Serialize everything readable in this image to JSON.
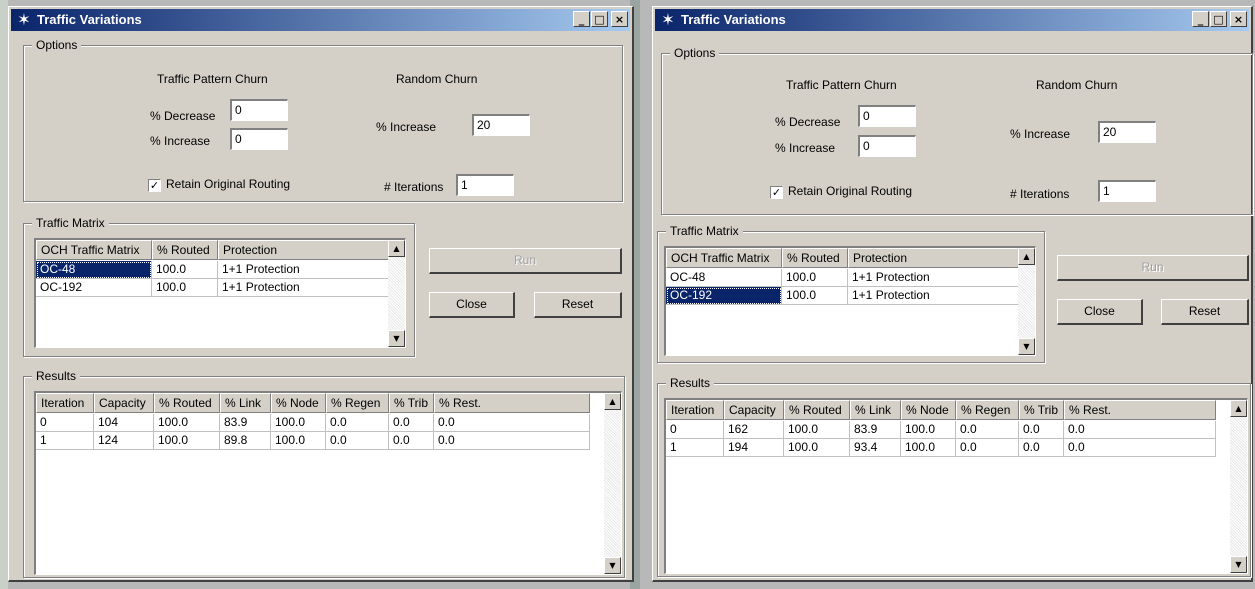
{
  "windows": [
    {
      "title": "Traffic Variations",
      "title_buttons": {
        "minimize": "_",
        "maximize": "□",
        "close": "×"
      },
      "options": {
        "legend": "Options",
        "traffic_pattern_churn": "Traffic Pattern Churn",
        "random_churn": "Random Churn",
        "decrease_label": "% Decrease",
        "decrease_value": "0",
        "increase_label": "% Increase",
        "increase_value": "0",
        "random_increase_label": "% Increase",
        "random_increase_value": "20",
        "retain_label": "Retain Original Routing",
        "retain_checked": "✓",
        "iterations_label": "# Iterations",
        "iterations_value": "1"
      },
      "traffic_matrix": {
        "legend": "Traffic Matrix",
        "headers": [
          "OCH Traffic Matrix",
          "% Routed",
          "Protection"
        ],
        "rows": [
          [
            "OC-48",
            "100.0",
            "1+1 Protection"
          ],
          [
            "OC-192",
            "100.0",
            "1+1 Protection"
          ]
        ],
        "selected_row": 0
      },
      "buttons": {
        "run": "Run",
        "close": "Close",
        "reset": "Reset"
      },
      "results": {
        "legend": "Results",
        "headers": [
          "Iteration",
          "Capacity",
          "% Routed",
          "% Link",
          "% Node",
          "% Regen",
          "% Trib",
          "% Rest."
        ],
        "rows": [
          [
            "0",
            "104",
            "100.0",
            "83.9",
            "100.0",
            "0.0",
            "0.0",
            "0.0"
          ],
          [
            "1",
            "124",
            "100.0",
            "89.8",
            "100.0",
            "0.0",
            "0.0",
            "0.0"
          ]
        ]
      }
    },
    {
      "title": "Traffic Variations",
      "title_buttons": {
        "minimize": "_",
        "maximize": "□",
        "close": "×"
      },
      "options": {
        "legend": "Options",
        "traffic_pattern_churn": "Traffic Pattern Churn",
        "random_churn": "Random Churn",
        "decrease_label": "% Decrease",
        "decrease_value": "0",
        "increase_label": "% Increase",
        "increase_value": "0",
        "random_increase_label": "% Increase",
        "random_increase_value": "20",
        "retain_label": "Retain Original Routing",
        "retain_checked": "✓",
        "iterations_label": "# Iterations",
        "iterations_value": "1"
      },
      "traffic_matrix": {
        "legend": "Traffic Matrix",
        "headers": [
          "OCH Traffic Matrix",
          "% Routed",
          "Protection"
        ],
        "rows": [
          [
            "OC-48",
            "100.0",
            "1+1 Protection"
          ],
          [
            "OC-192",
            "100.0",
            "1+1 Protection"
          ]
        ],
        "selected_row": 1
      },
      "buttons": {
        "run": "Run",
        "close": "Close",
        "reset": "Reset"
      },
      "results": {
        "legend": "Results",
        "headers": [
          "Iteration",
          "Capacity",
          "% Routed",
          "% Link",
          "% Node",
          "% Regen",
          "% Trib",
          "% Rest."
        ],
        "rows": [
          [
            "0",
            "162",
            "100.0",
            "83.9",
            "100.0",
            "0.0",
            "0.0",
            "0.0"
          ],
          [
            "1",
            "194",
            "100.0",
            "93.4",
            "100.0",
            "0.0",
            "0.0",
            "0.0"
          ]
        ]
      }
    }
  ],
  "colors": {
    "title_active": "#0a246a",
    "face": "#d4d0c8",
    "selection": "#0a246a"
  }
}
